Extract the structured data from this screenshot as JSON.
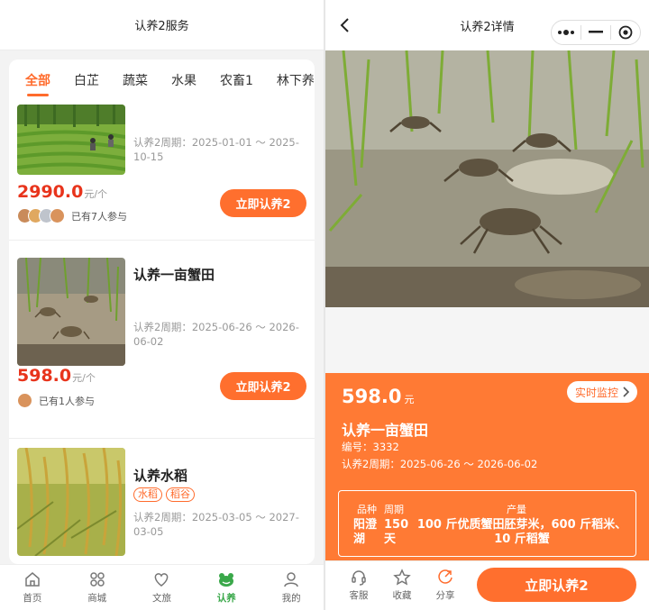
{
  "left": {
    "nav_title": "认养2服务",
    "tabs": [
      "全部",
      "白芷",
      "蔬菜",
      "水果",
      "农畜1",
      "林下养"
    ],
    "items": [
      {
        "title": "",
        "period": "认养2周期：2025-01-01 ～ 2025-10-15",
        "price": "2990.0",
        "unit": "元/个",
        "joined": "已有7人参与",
        "button": "立即认养2",
        "tags": []
      },
      {
        "title": "认养一亩蟹田",
        "period": "认养2周期：2025-06-26 ～ 2026-06-02",
        "price": "598.0",
        "unit": "元/个",
        "joined": "已有1人参与",
        "button": "立即认养2",
        "tags": []
      },
      {
        "title": "认养水稻",
        "period": "认养2周期：2025-03-05 ～ 2027-03-05",
        "tags": [
          "水稻",
          "稻谷"
        ]
      }
    ],
    "tabbar": [
      {
        "label": "首页",
        "icon": "home-icon"
      },
      {
        "label": "商城",
        "icon": "grid-icon"
      },
      {
        "label": "文旅",
        "icon": "heart-icon"
      },
      {
        "label": "认养",
        "icon": "frog-icon"
      },
      {
        "label": "我的",
        "icon": "user-icon"
      }
    ],
    "accent": "#ff6b2c",
    "active_tab_color": "#3aa84a"
  },
  "right": {
    "nav_title": "认养2详情",
    "price": "598.0",
    "unit": "元",
    "monitor_label": "实时监控",
    "title": "认养一亩蟹田",
    "code": "编号：3332",
    "period": "认养2周期：2025-06-26 ～ 2026-06-02",
    "spec": {
      "headers": [
        "品种",
        "周期",
        "产量"
      ],
      "variety": "阳澄湖",
      "cycle_num": "150",
      "cycle_unit": "天",
      "yield": "100 斤优质蟹田胚芽米，600 斤稻米、10 斤稻蟹"
    },
    "actions": [
      {
        "label": "客服",
        "icon": "headset-icon"
      },
      {
        "label": "收藏",
        "icon": "star-icon"
      },
      {
        "label": "分享",
        "icon": "share-icon"
      }
    ],
    "adopt_button": "立即认养2",
    "panel_color": "#ff7a34"
  }
}
